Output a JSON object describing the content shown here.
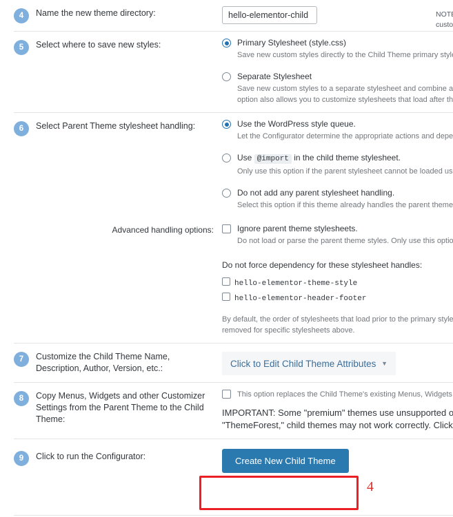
{
  "steps": {
    "s4": {
      "number": "4",
      "label": "Name the new theme directory:",
      "input_value": "hello-elementor-child",
      "input_placeholder": "",
      "note_line1": "NOTE: This",
      "note_line2": "customize t"
    },
    "s5": {
      "number": "5",
      "label": "Select where to save new styles:",
      "options": [
        {
          "title": "Primary Stylesheet (style.css)",
          "desc_line1": "Save new custom styles directly to the Child Theme primary stylesheet, replac",
          "desc_line2": "",
          "selected": true
        },
        {
          "title": "Separate Stylesheet",
          "desc_line1": "Save new custom styles to a separate stylesheet and combine any existing ch",
          "desc_line2": "option also allows you to customize stylesheets that load after the primary st",
          "selected": false
        }
      ]
    },
    "s6": {
      "number": "6",
      "label": "Select Parent Theme stylesheet handling:",
      "options": [
        {
          "title_pre": "Use the WordPress style queue.",
          "code": "",
          "title_post": "",
          "desc_line1": "Let the Configurator determine the appropriate actions and dependencies ar",
          "desc_line2": "",
          "selected": true
        },
        {
          "title_pre": "Use",
          "code": "@import",
          "title_post": "in the child theme stylesheet.",
          "desc_line1": "Only use this option if the parent stylesheet cannot be loaded using the Wor",
          "desc_line2": "",
          "selected": false
        },
        {
          "title_pre": "Do not add any parent stylesheet handling.",
          "code": "",
          "title_post": "",
          "desc_line1": "Select this option if this theme already handles the parent theme stylesheet c",
          "desc_line2": "",
          "selected": false
        }
      ],
      "advanced": {
        "label": "Advanced handling options:",
        "ignore_title": "Ignore parent theme stylesheets.",
        "ignore_desc": "Do not load or parse the parent theme styles. Only use this option if the Chil",
        "ignore_checked": false,
        "handles_title": "Do not force dependency for these stylesheet handles:",
        "handles": [
          {
            "label": "hello-elementor-theme-style",
            "checked": false
          },
          {
            "label": "hello-elementor-header-footer",
            "checked": false
          }
        ],
        "footnote_line1": "By default, the order of stylesheets that load prior to the primary stylesheet i",
        "footnote_line2": "removed for specific stylesheets above."
      }
    },
    "s7": {
      "number": "7",
      "label_line1": "Customize the Child Theme Name, Description,",
      "label_line2": "Author, Version, etc.:",
      "panel_link": "Click to Edit Child Theme Attributes",
      "panel_caret": "▼"
    },
    "s8": {
      "number": "8",
      "label_line1": "Copy Menus, Widgets and other Customizer",
      "label_line2": "Settings from the Parent Theme to the Child",
      "label_line3": "Theme:",
      "checkbox_label": "This option replaces the Child Theme's existing Menus, Widgets and other Cu",
      "checkbox_checked": false,
      "important_line1": "IMPORTANT: Some \"premium\" themes use unsupported opt",
      "important_line2": "\"ThemeForest,\" child themes may not work correctly. Click th"
    },
    "s9": {
      "number": "9",
      "label": "Click to run the Configurator:",
      "button_label": "Create New Child Theme",
      "annotation_number": "4"
    }
  },
  "colors": {
    "badge": "#7fb0dd",
    "accent": "#2271b1",
    "button": "#2a7ab0",
    "annotation": "#ec2024",
    "link": "#3c6e9a"
  }
}
